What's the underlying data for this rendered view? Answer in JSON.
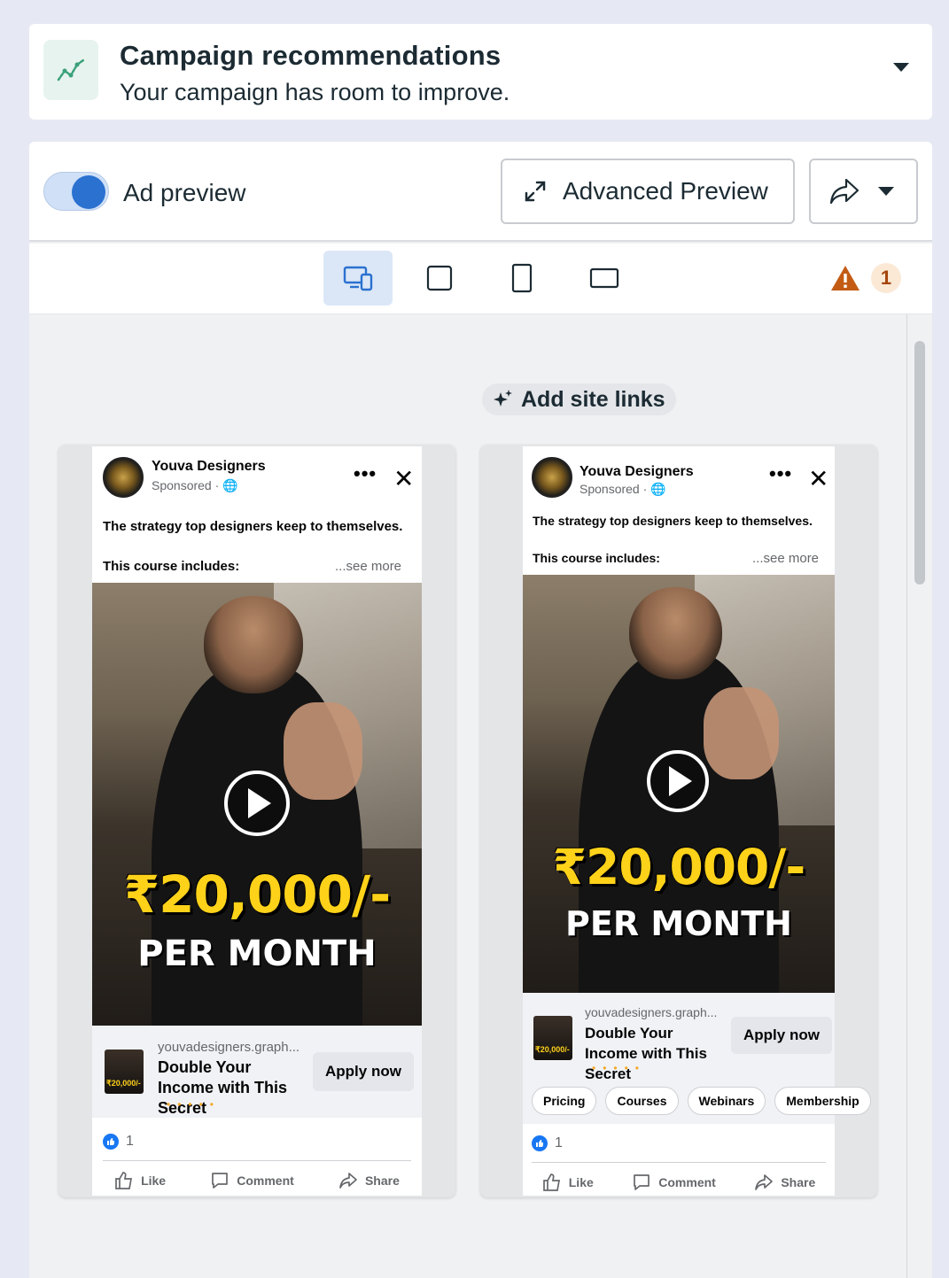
{
  "recommendations": {
    "title": "Campaign recommendations",
    "subtitle": "Your campaign has room to improve."
  },
  "preview": {
    "toggle_label": "Ad preview",
    "toggle_on": true,
    "advanced_preview_label": "Advanced Preview",
    "warning_count": "1",
    "add_site_links_label": "Add site links",
    "formats": [
      "responsive-icon",
      "square-icon",
      "portrait-icon",
      "landscape-icon"
    ],
    "active_format": "responsive-icon"
  },
  "ads": [
    {
      "page_name": "Youva Designers",
      "sponsored": "Sponsored ·",
      "primary_text": "The strategy top designers keep to themselves.",
      "course_text": "This course includes:",
      "see_more": "...see more",
      "media_amount": "₹20,000/-",
      "media_caption": "PER MONTH",
      "thumb_text": "₹20,000/-",
      "domain": "youvadesigners.graph...",
      "headline": "Double Your Income with This Secret",
      "cta": "Apply now",
      "reaction_count": "1",
      "like": "Like",
      "comment": "Comment",
      "share": "Share"
    },
    {
      "page_name": "Youva Designers",
      "sponsored": "Sponsored ·",
      "primary_text": "The strategy top designers keep to themselves.",
      "course_text": "This course includes:",
      "see_more": "...see more",
      "media_amount": "₹20,000/-",
      "media_caption": "PER MONTH",
      "thumb_text": "₹20,000/-",
      "domain": "youvadesigners.graph...",
      "headline": "Double Your Income with This Secret",
      "cta": "Apply now",
      "site_links": [
        "Pricing",
        "Courses",
        "Webinars",
        "Membership"
      ],
      "reaction_count": "1",
      "like": "Like",
      "comment": "Comment",
      "share": "Share"
    }
  ],
  "colors": {
    "accent": "#2a71d0",
    "warning": "#c35b14",
    "money": "#ffd21a"
  }
}
